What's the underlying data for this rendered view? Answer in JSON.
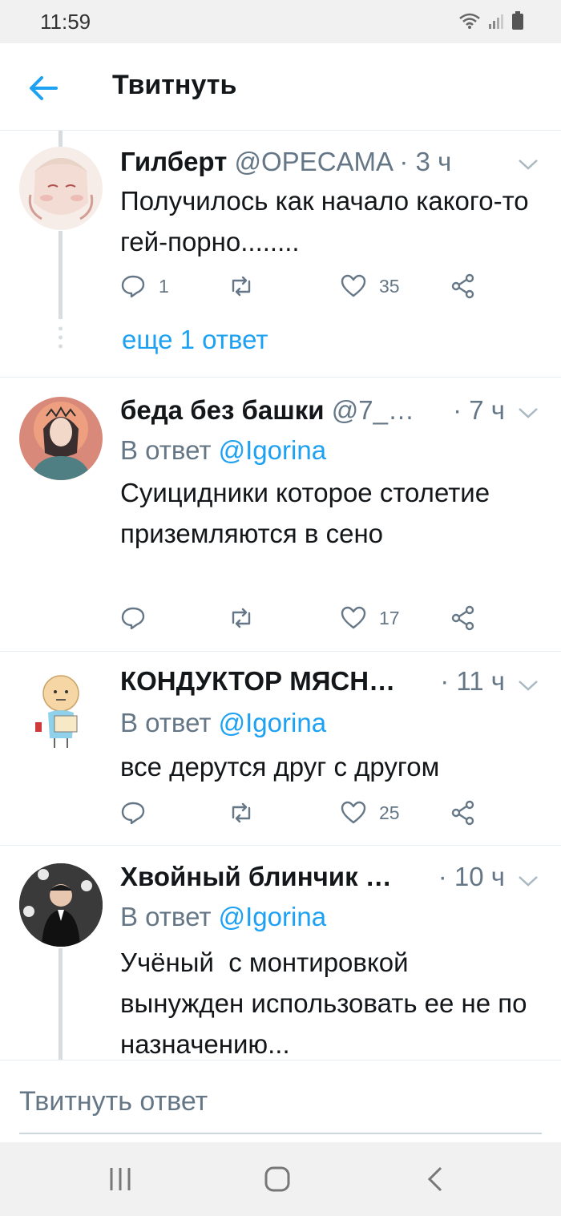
{
  "status": {
    "time": "11:59"
  },
  "header": {
    "title": "Твитнуть"
  },
  "tweets": [
    {
      "name": "Гилберт",
      "handle": "@OPECAMA",
      "time": "· 3 ч",
      "text": "Получилось как начало какого-то гей-порно........",
      "replies": "1",
      "likes": "35",
      "more_replies": "еще 1 ответ"
    },
    {
      "name": "беда без башки",
      "handle": "@7_…",
      "time": "· 7 ч",
      "reply_prefix": "В ответ",
      "reply_to": "@Igorina",
      "text": "Суицидники которое столетие приземляются в сено",
      "likes": "17"
    },
    {
      "name": "КОНДУКТОР МЯСН…",
      "time": "· 11 ч",
      "reply_prefix": "В ответ",
      "reply_to": "@Igorina",
      "text": "все дерутся друг с другом",
      "likes": "25"
    },
    {
      "name": "Хвойный блинчик …",
      "time": "· 10 ч",
      "reply_prefix": "В ответ",
      "reply_to": "@Igorina",
      "text": "Учёный  с монтировкой вынужден использовать ее не по назначению..."
    }
  ],
  "compose": {
    "placeholder": "Твитнуть ответ"
  },
  "colors": {
    "accent": "#1da1f2",
    "secondary_text": "#657786",
    "divider": "#e6ecf0"
  }
}
